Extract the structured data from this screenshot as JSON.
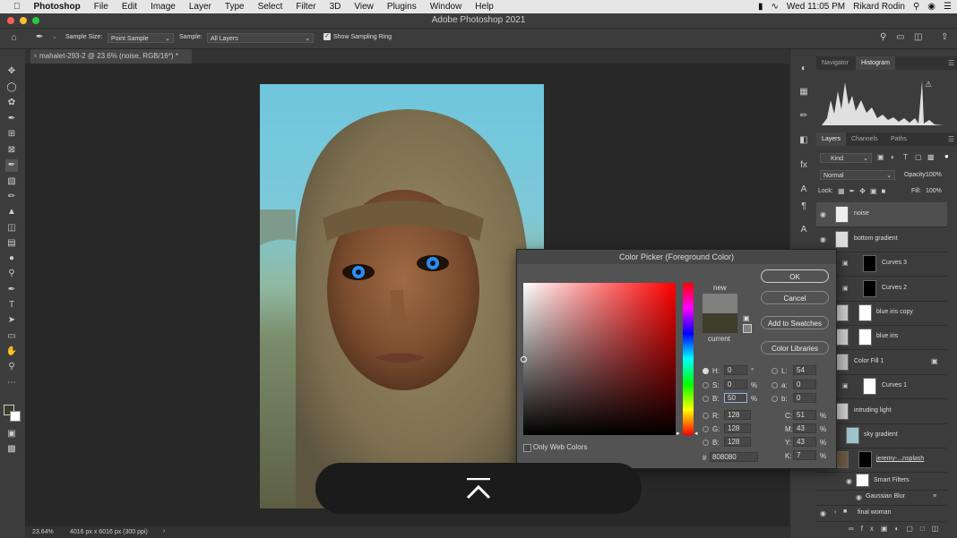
{
  "menubar": {
    "app": "Photoshop",
    "items": [
      "File",
      "Edit",
      "Image",
      "Layer",
      "Type",
      "Select",
      "Filter",
      "3D",
      "View",
      "Plugins",
      "Window",
      "Help"
    ],
    "datetime": "Wed 11:05 PM",
    "user": "Rikard Rodin"
  },
  "window": {
    "title": "Adobe Photoshop 2021"
  },
  "options": {
    "sample_size_label": "Sample Size:",
    "sample_size_value": "Point Sample",
    "sample_label": "Sample:",
    "sample_value": "All Layers",
    "show_ring_label": "Show Sampling Ring"
  },
  "document": {
    "tab": "mahalet-293-2 @ 23.6% (noise, RGB/16*) *"
  },
  "status": {
    "zoom": "23.64%",
    "info": "4016 px x 6016 px (300 ppi)"
  },
  "panels": {
    "top_tabs": [
      "Navigator",
      "Histogram"
    ],
    "layer_tabs": [
      "Layers",
      "Channels",
      "Paths"
    ],
    "kind_label": "Kind",
    "blend_mode": "Normal",
    "opacity_label": "Opacity:",
    "opacity_value": "100%",
    "lock_label": "Lock:",
    "fill_label": "Fill:",
    "fill_value": "100%",
    "layers": [
      {
        "name": "noise",
        "selected": true
      },
      {
        "name": "bottom gradient"
      },
      {
        "name": "Curves 3"
      },
      {
        "name": "Curves 2"
      },
      {
        "name": "blue iris copy"
      },
      {
        "name": "blue iris"
      },
      {
        "name": "Color Fill 1"
      },
      {
        "name": "Curves 1"
      },
      {
        "name": "intruding light"
      },
      {
        "name": "sky gradient"
      },
      {
        "name": "jeremy-...nsplash"
      }
    ],
    "smart_filters": "Smart Filters",
    "gaussian_blur": "Gaussian Blur",
    "group": "final woman"
  },
  "picker": {
    "title": "Color Picker (Foreground Color)",
    "ok": "OK",
    "cancel": "Cancel",
    "add_swatches": "Add to Swatches",
    "color_libraries": "Color Libraries",
    "new_label": "new",
    "current_label": "current",
    "only_web": "Only Web Colors",
    "new_color": "#808080",
    "current_color": "#3e3d2a",
    "hue_color": "#ff0000",
    "hex_label": "#",
    "hex": "808080",
    "h": {
      "label": "H:",
      "value": "0",
      "unit": "°"
    },
    "s": {
      "label": "S:",
      "value": "0",
      "unit": "%"
    },
    "b": {
      "label": "B:",
      "value": "50",
      "unit": "%"
    },
    "r": {
      "label": "R:",
      "value": "128"
    },
    "g": {
      "label": "G:",
      "value": "128"
    },
    "bb": {
      "label": "B:",
      "value": "128"
    },
    "l": {
      "label": "L:",
      "value": "54"
    },
    "a": {
      "label": "a:",
      "value": "0"
    },
    "blab": {
      "label": "b:",
      "value": "0"
    },
    "c": {
      "label": "C:",
      "value": "51",
      "unit": "%"
    },
    "m": {
      "label": "M:",
      "value": "43",
      "unit": "%"
    },
    "y": {
      "label": "Y:",
      "value": "43",
      "unit": "%"
    },
    "k": {
      "label": "K:",
      "value": "7",
      "unit": "%"
    }
  }
}
